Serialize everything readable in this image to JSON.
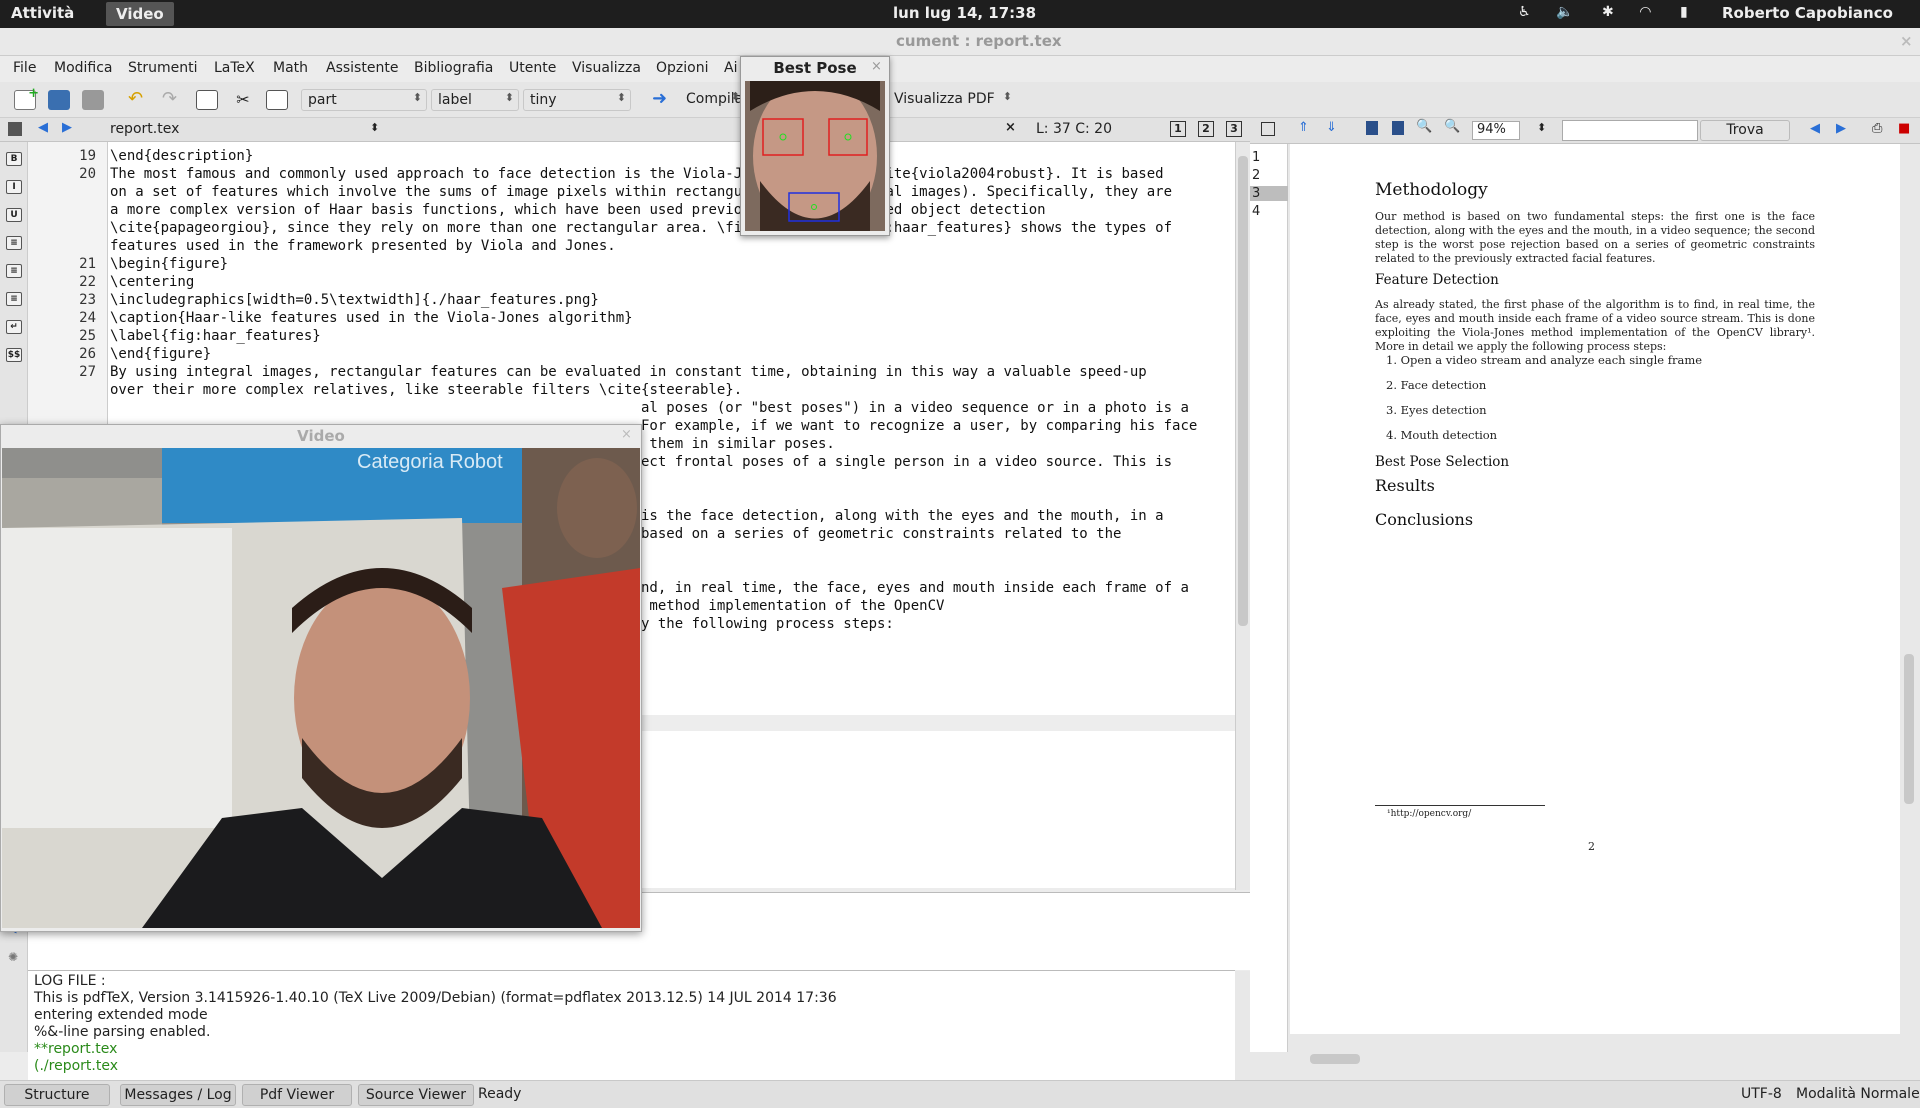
{
  "topbar": {
    "activities": "Attività",
    "app": "Video",
    "clock": "lun lug 14, 17:38",
    "user": "Roberto Capobianco"
  },
  "window": {
    "title": "cument : report.tex"
  },
  "menu": [
    "File",
    "Modifica",
    "Strumenti",
    "LaTeX",
    "Math",
    "Assistente",
    "Bibliografia",
    "Utente",
    "Visualizza",
    "Opzioni",
    "Ai"
  ],
  "toolbar": {
    "combo_part": "part",
    "combo_label": "label",
    "combo_size": "tiny",
    "compile": "Compila",
    "view": "Visualizza  PDF"
  },
  "editor": {
    "file": "report.tex",
    "position": "L: 37 C: 20",
    "lines": [
      {
        "n": "19",
        "t": "\\end{description}"
      },
      {
        "n": "20",
        "t": "The most famous and commonly used approach to face detection is the Viola-Jones algorithm \\cite{viola2004robust}. It is based"
      },
      {
        "n": "",
        "t": "on a set of features which involve the sums of image pixels within rectangular areas (integral images). Specifically, they are"
      },
      {
        "n": "",
        "t": "a more complex version of Haar basis functions, which have been used previously in image-based object detection"
      },
      {
        "n": "",
        "t": "\\cite{papageorgiou}, since they rely on more than one rectangular area. \\figurename~\\ref{fig:haar_features} shows the types of"
      },
      {
        "n": "",
        "t": "features used in the framework presented by Viola and Jones."
      },
      {
        "n": "21",
        "t": "\\begin{figure}"
      },
      {
        "n": "22",
        "t": "\\centering"
      },
      {
        "n": "23",
        "t": "\\includegraphics[width=0.5\\textwidth]{./haar_features.png}"
      },
      {
        "n": "24",
        "t": "\\caption{Haar-like features used in the Viola-Jones algorithm}"
      },
      {
        "n": "25",
        "t": "\\label{fig:haar_features}"
      },
      {
        "n": "26",
        "t": "\\end{figure}"
      },
      {
        "n": "27",
        "t": "By using integral images, rectangular features can be evaluated in constant time, obtaining in this way a valuable speed-up"
      },
      {
        "n": "",
        "t": "over their more complex relatives, like steerable filters \\cite{steerable}."
      }
    ],
    "hidden_lines": [
      "al poses (or \"best poses\") in a video sequence or in a photo is a",
      "For example, if we want to recognize a user, by comparing his face",
      " them in similar poses.",
      "ect frontal poses of a single person in a video source. This is",
      "",
      "",
      "is the face detection, along with the eyes and the mouth, in a",
      "based on a series of geometric constraints related to the",
      "",
      "",
      "nd, in real time, the face, eyes and mouth inside each frame of a",
      " method implementation of the OpenCV",
      "y the following process steps:"
    ]
  },
  "log": [
    "LOG FILE :",
    "This is pdfTeX, Version 3.1415926-1.40.10 (TeX Live 2009/Debian) (format=pdflatex 2013.12.5) 14 JUL 2014 17:36",
    "entering extended mode",
    "%&-line parsing enabled.",
    "**report.tex",
    "(./report.tex"
  ],
  "pdf": {
    "zoom": "94%",
    "find_button": "Trova",
    "pages": [
      "1",
      "2",
      "3",
      "4"
    ],
    "h1": "Methodology",
    "p1": "Our method is based on two fundamental steps: the first one is the face detection, along with the eyes and the mouth, in a video sequence; the second step is the worst pose rejection based on a series of geometric constraints related to the previously extracted facial features.",
    "h2": "Feature Detection",
    "p2": "As already stated, the first phase of the algorithm is to find, in real time, the face, eyes and mouth inside each frame of a video source stream. This is done exploiting the Viola-Jones method implementation of the OpenCV library¹. More in detail we apply the following process steps:",
    "steps": [
      "1.  Open a video stream and analyze each single frame",
      "2.  Face detection",
      "3.  Eyes detection",
      "4.  Mouth detection"
    ],
    "h3": "Best Pose Selection",
    "h4": "Results",
    "h5": "Conclusions",
    "footnote": "¹http://opencv.org/",
    "page_number": "2"
  },
  "video": {
    "title": "Video",
    "banner": "Categoria Robot"
  },
  "bestpose": {
    "title": "Best Pose"
  },
  "status": {
    "tabs": [
      "Structure",
      "Messages / Log",
      "Pdf Viewer",
      "Source Viewer"
    ],
    "state": "Ready",
    "encoding": "UTF-8",
    "mode": "Modalità Normale"
  }
}
